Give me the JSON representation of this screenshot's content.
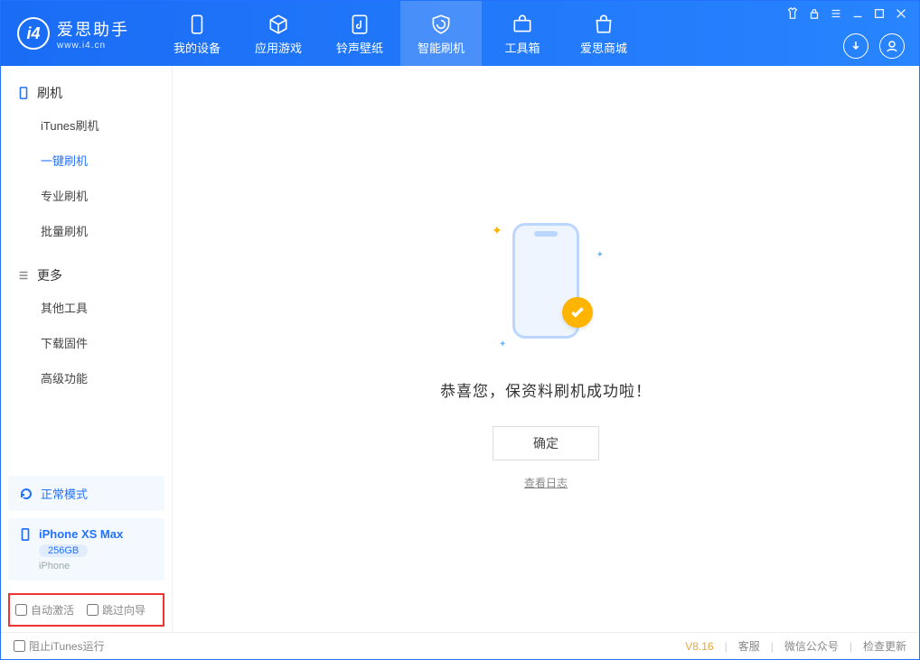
{
  "logo": {
    "name": "爱思助手",
    "url": "www.i4.cn"
  },
  "nav": {
    "items": [
      {
        "label": "我的设备"
      },
      {
        "label": "应用游戏"
      },
      {
        "label": "铃声壁纸"
      },
      {
        "label": "智能刷机"
      },
      {
        "label": "工具箱"
      },
      {
        "label": "爱思商城"
      }
    ]
  },
  "sidebar": {
    "section1": {
      "title": "刷机",
      "items": [
        "iTunes刷机",
        "一键刷机",
        "专业刷机",
        "批量刷机"
      ]
    },
    "section2": {
      "title": "更多",
      "items": [
        "其他工具",
        "下载固件",
        "高级功能"
      ]
    },
    "mode": "正常模式",
    "device": {
      "name": "iPhone XS Max",
      "storage": "256GB",
      "type": "iPhone"
    },
    "options": {
      "auto_activate": "自动激活",
      "skip_guide": "跳过向导"
    }
  },
  "main": {
    "message": "恭喜您，保资料刷机成功啦！",
    "confirm": "确定",
    "log_link": "查看日志"
  },
  "footer": {
    "block_itunes": "阻止iTunes运行",
    "version": "V8.16",
    "links": [
      "客服",
      "微信公众号",
      "检查更新"
    ]
  }
}
